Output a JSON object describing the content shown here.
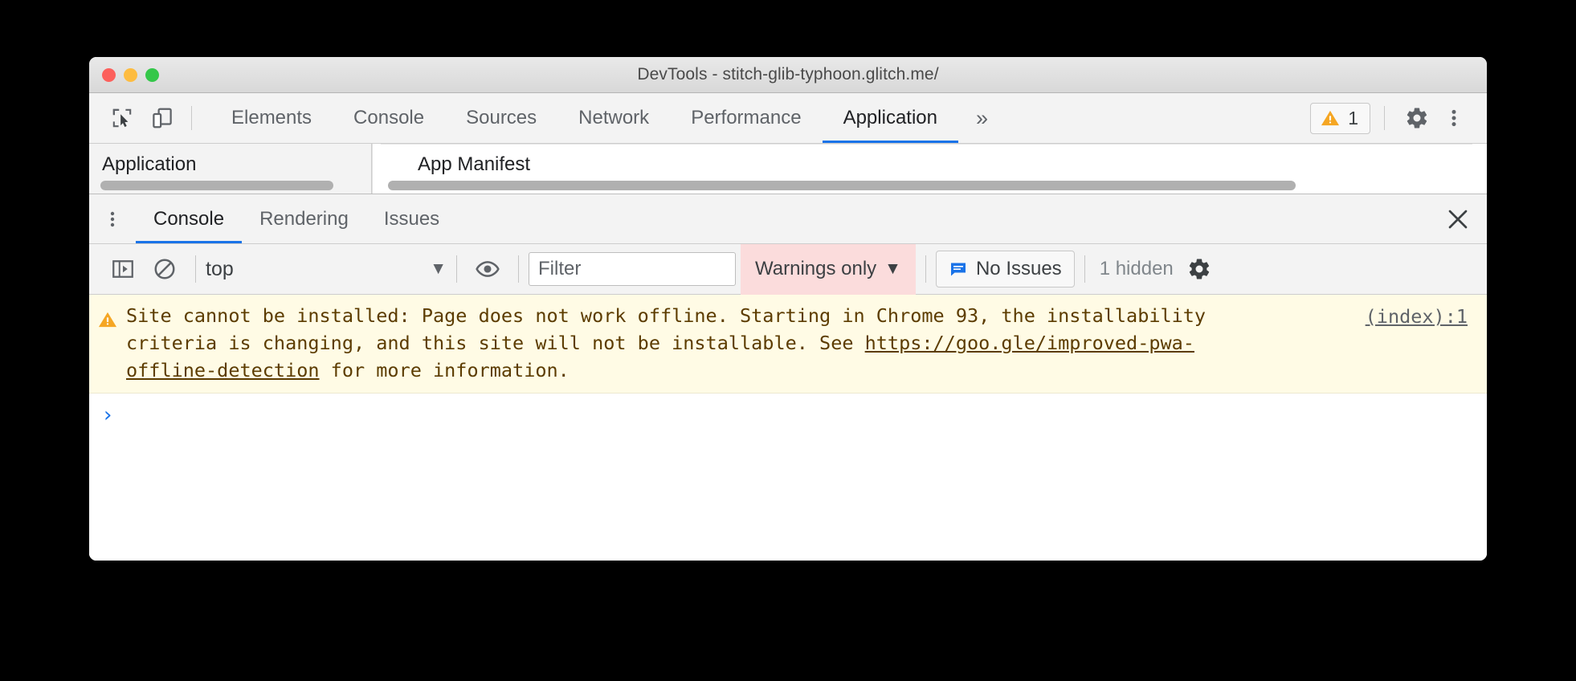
{
  "window": {
    "title": "DevTools - stitch-glib-typhoon.glitch.me/",
    "traffic": {
      "close_label": "close-window",
      "minimize_label": "minimize-window",
      "maximize_label": "maximize-window"
    }
  },
  "devtools_tabbar": {
    "inspect_icon": "inspect-element-icon",
    "device_icon": "device-toolbar-icon",
    "tabs": [
      {
        "label": "Elements",
        "active": false
      },
      {
        "label": "Console",
        "active": false
      },
      {
        "label": "Sources",
        "active": false
      },
      {
        "label": "Network",
        "active": false
      },
      {
        "label": "Performance",
        "active": false
      },
      {
        "label": "Application",
        "active": true
      }
    ],
    "more_tabs_label": "»",
    "warning_badge": {
      "icon": "warning-triangle-icon",
      "count": "1"
    },
    "settings_icon": "gear-icon",
    "menu_icon": "three-dot-menu-icon"
  },
  "panel_peek": {
    "sidebar_title": "Application",
    "main_title": "App Manifest"
  },
  "drawer": {
    "menu_icon": "three-dot-menu-icon",
    "tabs": [
      {
        "label": "Console",
        "active": true
      },
      {
        "label": "Rendering",
        "active": false
      },
      {
        "label": "Issues",
        "active": false
      }
    ],
    "close_icon": "close-icon"
  },
  "console_toolbar": {
    "sidebar_toggle_icon": "console-sidebar-icon",
    "clear_icon": "clear-console-icon",
    "context": {
      "value": "top",
      "caret": "▼"
    },
    "eye_icon": "live-expression-icon",
    "filter": {
      "value": "",
      "placeholder": "Filter"
    },
    "level": {
      "value": "Warnings only",
      "caret": "▼"
    },
    "issues": {
      "icon": "issues-message-icon",
      "label": "No Issues"
    },
    "hidden_count": "1 hidden",
    "settings_icon": "gear-icon"
  },
  "console": {
    "message": {
      "icon": "warning-triangle-icon",
      "text_before_link": "Site cannot be installed: Page does not work offline. Starting in Chrome 93, the installability criteria is changing, and this site will not be installable. See ",
      "link_text": "https://goo.gle/improved-pwa-offline-detection",
      "text_after_link": " for more information.",
      "source": "(index):1"
    },
    "prompt_symbol": "›"
  },
  "colors": {
    "accent_blue": "#1a73e8",
    "warning_yellow": "#f5a623",
    "warning_bg": "#fffbe5",
    "level_highlight_bg": "#fbdcdc",
    "traffic_close": "#fc605c",
    "traffic_min": "#fdbc40",
    "traffic_max": "#34c749"
  }
}
